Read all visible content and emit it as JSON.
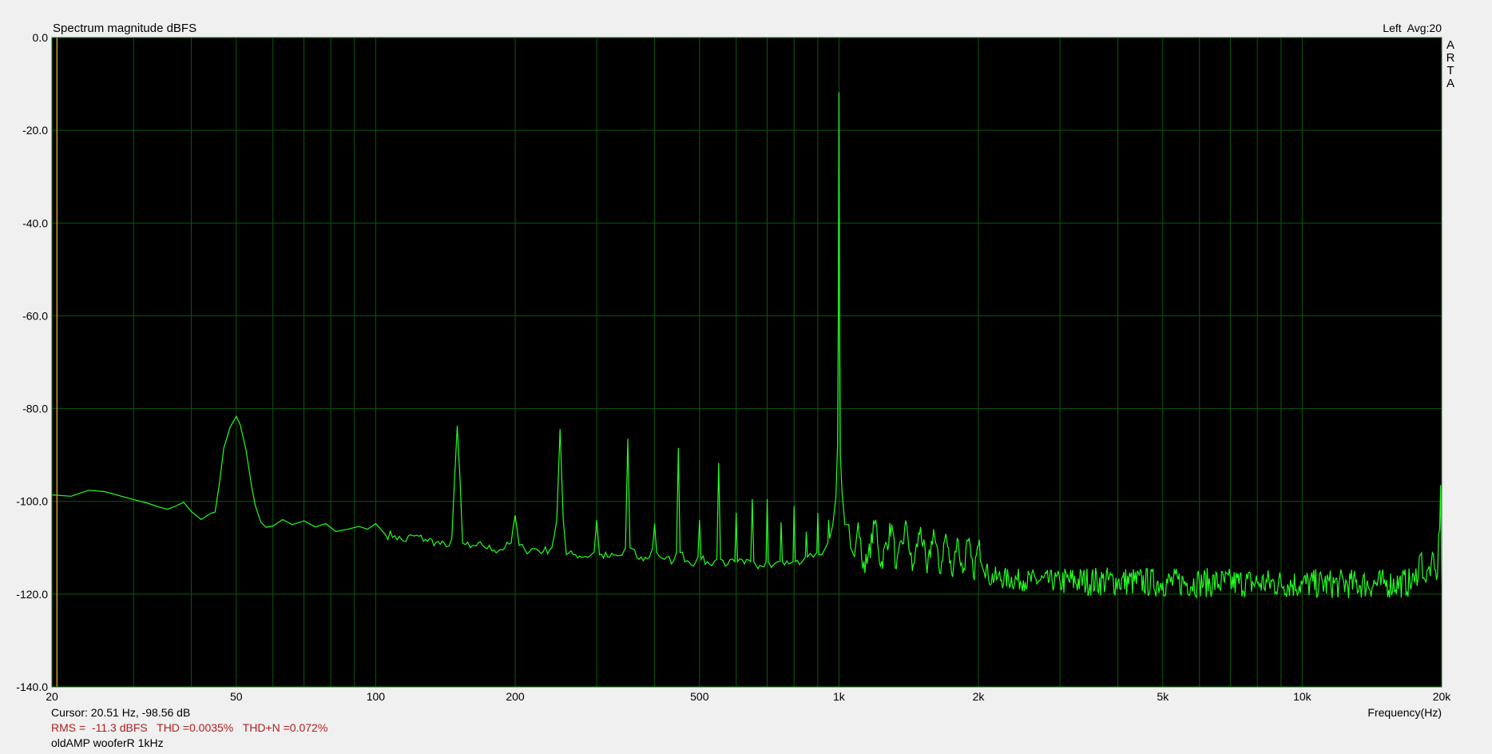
{
  "chart_data": {
    "type": "line",
    "title": "Spectrum magnitude dBFS",
    "channel_label": "Left  Avg:20",
    "vertical_brand": [
      "A",
      "R",
      "T",
      "A"
    ],
    "xlabel": "Frequency(Hz)",
    "ylabel": "",
    "x_scale": "log",
    "xlim": [
      20,
      20000
    ],
    "ylim": [
      -140,
      0
    ],
    "x_ticks": [
      {
        "value": 20,
        "label": "20"
      },
      {
        "value": 50,
        "label": "50"
      },
      {
        "value": 100,
        "label": "100"
      },
      {
        "value": 200,
        "label": "200"
      },
      {
        "value": 500,
        "label": "500"
      },
      {
        "value": 1000,
        "label": "1k"
      },
      {
        "value": 2000,
        "label": "2k"
      },
      {
        "value": 5000,
        "label": "5k"
      },
      {
        "value": 10000,
        "label": "10k"
      },
      {
        "value": 20000,
        "label": "20k"
      }
    ],
    "y_ticks": [
      {
        "value": 0,
        "label": "0.0"
      },
      {
        "value": -20,
        "label": "-20.0"
      },
      {
        "value": -40,
        "label": "-40.0"
      },
      {
        "value": -60,
        "label": "-60.0"
      },
      {
        "value": -80,
        "label": "-80.0"
      },
      {
        "value": -100,
        "label": "-100.0"
      },
      {
        "value": -120,
        "label": "-120.0"
      },
      {
        "value": -140,
        "label": "-140.0"
      }
    ],
    "grid": true,
    "cursor_freq": 20.51,
    "colors": {
      "background": "#000000",
      "grid": "#0c5a0c",
      "trace": "#22ff22",
      "frame": "#1a7a1a",
      "cursor": "#c8a020",
      "stats": "#b02020"
    },
    "series": [
      {
        "color": "#22ff22",
        "points": [
          [
            20,
            -98.6
          ],
          [
            22,
            -98.9
          ],
          [
            24,
            -97.6
          ],
          [
            26,
            -97.9
          ],
          [
            28,
            -98.8
          ],
          [
            30,
            -99.6
          ],
          [
            32,
            -100.3
          ],
          [
            34,
            -101.2
          ],
          [
            35.5,
            -101.7
          ],
          [
            37,
            -101.0
          ],
          [
            38.5,
            -100.2
          ],
          [
            40,
            -102.2
          ],
          [
            42,
            -103.9
          ],
          [
            44,
            -102.6
          ],
          [
            45,
            -102.3
          ],
          [
            46,
            -96.0
          ],
          [
            47,
            -88.5
          ],
          [
            48.5,
            -84.0
          ],
          [
            50,
            -81.7
          ],
          [
            51,
            -83.5
          ],
          [
            52.5,
            -89.0
          ],
          [
            54,
            -97.0
          ],
          [
            55,
            -101.0
          ],
          [
            56.5,
            -104.5
          ],
          [
            58,
            -105.6
          ],
          [
            60,
            -105.3
          ],
          [
            63,
            -103.9
          ],
          [
            66,
            -105.0
          ],
          [
            70,
            -104.2
          ],
          [
            74,
            -105.5
          ],
          [
            78,
            -104.8
          ],
          [
            82,
            -106.5
          ],
          [
            87,
            -106.0
          ],
          [
            92,
            -105.4
          ],
          [
            96,
            -106.0
          ],
          [
            100,
            -104.8
          ],
          [
            105,
            -107.2
          ],
          [
            110,
            -107.4
          ],
          [
            115,
            -108.6
          ],
          [
            120,
            -107.4
          ],
          [
            128,
            -108.2
          ],
          [
            135,
            -108.8
          ],
          [
            142,
            -109.8
          ],
          [
            146,
            -108.0
          ],
          [
            148,
            -95.0
          ],
          [
            150,
            -83.7
          ],
          [
            152,
            -95.0
          ],
          [
            154,
            -109.0
          ],
          [
            160,
            -110.0
          ],
          [
            170,
            -109.5
          ],
          [
            180,
            -110.5
          ],
          [
            190,
            -110.0
          ],
          [
            196,
            -109.0
          ],
          [
            200,
            -103.0
          ],
          [
            204,
            -109.5
          ],
          [
            210,
            -110.5
          ],
          [
            220,
            -110.2
          ],
          [
            230,
            -110.8
          ],
          [
            240,
            -110.0
          ],
          [
            246,
            -104.0
          ],
          [
            250,
            -84.4
          ],
          [
            254,
            -104.0
          ],
          [
            258,
            -111.5
          ],
          [
            270,
            -111.5
          ],
          [
            290,
            -111.8
          ],
          [
            296,
            -111.0
          ],
          [
            300,
            -104.0
          ],
          [
            304,
            -111.5
          ],
          [
            320,
            -112.0
          ],
          [
            340,
            -111.6
          ],
          [
            346,
            -110.0
          ],
          [
            350,
            -86.5
          ],
          [
            354,
            -110.0
          ],
          [
            370,
            -112.5
          ],
          [
            390,
            -112.0
          ],
          [
            396,
            -110.0
          ],
          [
            400,
            -104.8
          ],
          [
            404,
            -111.0
          ],
          [
            420,
            -112.5
          ],
          [
            440,
            -112.8
          ],
          [
            446,
            -111.0
          ],
          [
            450,
            -88.5
          ],
          [
            454,
            -111.0
          ],
          [
            470,
            -112.8
          ],
          [
            490,
            -113.2
          ],
          [
            496,
            -112.0
          ],
          [
            500,
            -104.0
          ],
          [
            504,
            -112.5
          ],
          [
            525,
            -113.5
          ],
          [
            545,
            -112.5
          ],
          [
            550,
            -91.7
          ],
          [
            555,
            -112.5
          ],
          [
            575,
            -113.6
          ],
          [
            596,
            -113.0
          ],
          [
            600,
            -102.5
          ],
          [
            604,
            -113.0
          ],
          [
            625,
            -113.5
          ],
          [
            645,
            -113.0
          ],
          [
            650,
            -99.5
          ],
          [
            655,
            -113.0
          ],
          [
            675,
            -113.8
          ],
          [
            696,
            -113.0
          ],
          [
            700,
            -99.5
          ],
          [
            704,
            -113.0
          ],
          [
            725,
            -113.5
          ],
          [
            746,
            -113.0
          ],
          [
            750,
            -104.5
          ],
          [
            755,
            -113.0
          ],
          [
            780,
            -113.5
          ],
          [
            796,
            -113.0
          ],
          [
            800,
            -101.0
          ],
          [
            805,
            -113.0
          ],
          [
            830,
            -113.2
          ],
          [
            846,
            -112.0
          ],
          [
            850,
            -106.5
          ],
          [
            855,
            -112.0
          ],
          [
            880,
            -112.0
          ],
          [
            896,
            -111.0
          ],
          [
            900,
            -102.5
          ],
          [
            905,
            -111.5
          ],
          [
            930,
            -110.5
          ],
          [
            946,
            -109.0
          ],
          [
            950,
            -104.0
          ],
          [
            955,
            -108.0
          ],
          [
            970,
            -105.0
          ],
          [
            985,
            -99.0
          ],
          [
            993,
            -88.0
          ],
          [
            997,
            -60.0
          ],
          [
            1000,
            -11.8
          ],
          [
            1003,
            -60.0
          ],
          [
            1007,
            -90.0
          ],
          [
            1015,
            -98.0
          ],
          [
            1030,
            -105.0
          ],
          [
            1050,
            -105.0
          ],
          [
            1060,
            -110.0
          ],
          [
            1080,
            -112.0
          ],
          [
            1100,
            -104.5
          ],
          [
            1120,
            -112.5
          ],
          [
            1150,
            -113.5
          ],
          [
            1200,
            -104.0
          ],
          [
            1230,
            -114.0
          ],
          [
            1300,
            -105.0
          ],
          [
            1330,
            -114.5
          ],
          [
            1400,
            -105.0
          ],
          [
            1440,
            -115.0
          ],
          [
            1500,
            -105.5
          ],
          [
            1550,
            -115.5
          ],
          [
            1600,
            -106.0
          ],
          [
            1650,
            -115.5
          ],
          [
            1700,
            -107.0
          ],
          [
            1750,
            -115.5
          ],
          [
            1800,
            -108.0
          ],
          [
            1850,
            -115.5
          ],
          [
            1900,
            -108.5
          ],
          [
            1950,
            -116.0
          ],
          [
            2000,
            -109.5
          ],
          [
            2100,
            -116.2
          ],
          [
            2200,
            -116.5
          ],
          [
            2500,
            -117.0
          ],
          [
            3000,
            -117.2
          ],
          [
            4000,
            -117.2
          ],
          [
            5000,
            -117.5
          ],
          [
            6000,
            -117.5
          ],
          [
            8000,
            -117.6
          ],
          [
            10000,
            -117.8
          ],
          [
            12000,
            -117.8
          ],
          [
            15000,
            -117.8
          ],
          [
            17500,
            -117.5
          ],
          [
            18000,
            -111.5
          ],
          [
            18500,
            -117.5
          ],
          [
            19000,
            -113.0
          ],
          [
            19500,
            -117.0
          ],
          [
            19800,
            -106.0
          ],
          [
            19900,
            -96.5
          ],
          [
            20000,
            -118.0
          ]
        ]
      }
    ]
  },
  "info": {
    "cursor": "Cursor: 20.51 Hz, -98.56 dB",
    "stats": "RMS =  -11.3 dBFS   THD =0.0035%   THD+N =0.072%",
    "name": "oldAMP wooferR 1kHz"
  }
}
